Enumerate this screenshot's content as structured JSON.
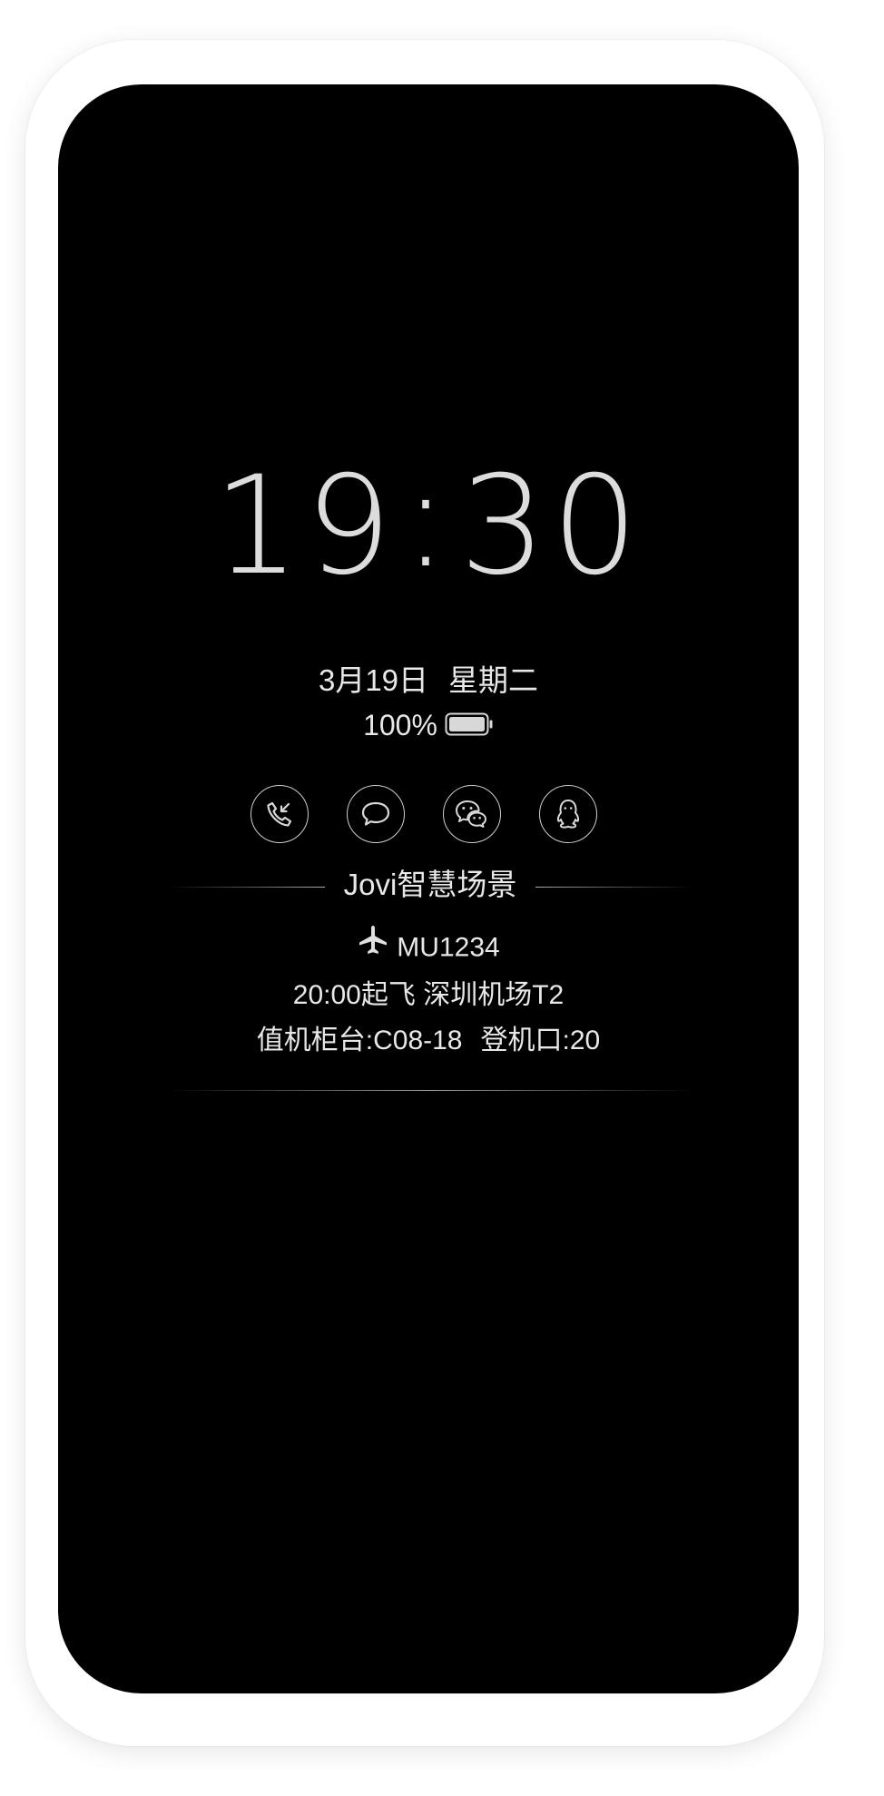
{
  "lockscreen": {
    "time_hours": "19",
    "time_separator": ":",
    "time_minutes": "30",
    "date": "3月19日",
    "weekday": "星期二",
    "battery_level": "100%"
  },
  "notification_apps": [
    {
      "icon": "phone-missed-call-icon"
    },
    {
      "icon": "message-bubble-icon"
    },
    {
      "icon": "wechat-icon"
    },
    {
      "icon": "qq-penguin-icon"
    }
  ],
  "jovi_card": {
    "title": "Jovi智慧场景",
    "flight_icon": "airplane-icon",
    "flight_number": "MU1234",
    "departure_time": "20:00起飞",
    "departure_airport": "深圳机场T2",
    "checkin_counter": "值机柜台:C08-18",
    "boarding_gate": "登机口:20"
  },
  "colors": {
    "screen_background": "#000000",
    "text": "#e8e8e8",
    "clock_text": "#dcdcdc",
    "frame": "#ffffff"
  }
}
